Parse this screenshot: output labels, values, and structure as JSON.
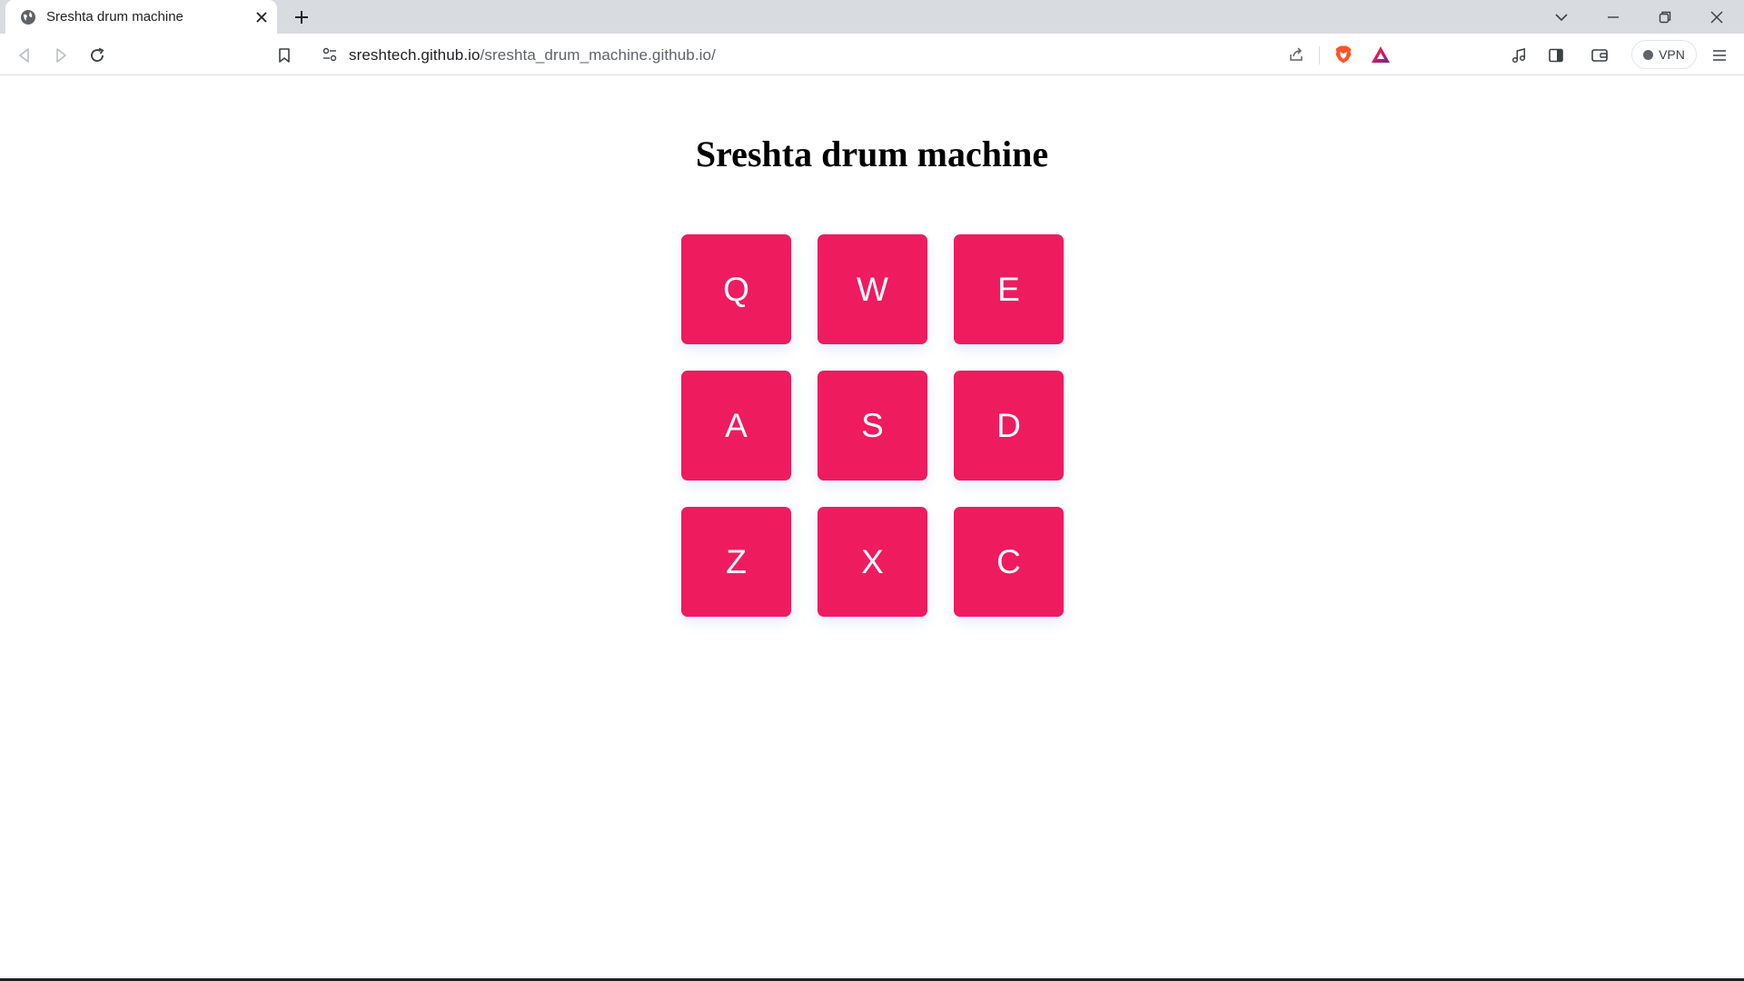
{
  "browser": {
    "tab": {
      "title": "Sreshta drum machine"
    },
    "address": {
      "host": "sreshtech.github.io",
      "path": "/sreshta_drum_machine.github.io/"
    },
    "vpn_label": "VPN"
  },
  "page": {
    "title": "Sreshta drum machine",
    "pad_color": "#ef1b5f",
    "pads": [
      {
        "key": "Q"
      },
      {
        "key": "W"
      },
      {
        "key": "E"
      },
      {
        "key": "A"
      },
      {
        "key": "S"
      },
      {
        "key": "D"
      },
      {
        "key": "Z"
      },
      {
        "key": "X"
      },
      {
        "key": "C"
      }
    ]
  },
  "icons": {
    "tab": [
      "globe-icon",
      "close-icon",
      "plus-icon"
    ],
    "window": [
      "chevron-down-icon",
      "minimize-icon",
      "restore-icon",
      "close-icon"
    ],
    "toolbar": [
      "back-icon",
      "forward-icon",
      "reload-icon",
      "bookmark-icon",
      "site-settings-icon",
      "share-icon",
      "brave-shield-icon",
      "brave-rewards-icon",
      "media-icon",
      "sidebar-icon",
      "wallet-icon",
      "menu-icon"
    ]
  }
}
